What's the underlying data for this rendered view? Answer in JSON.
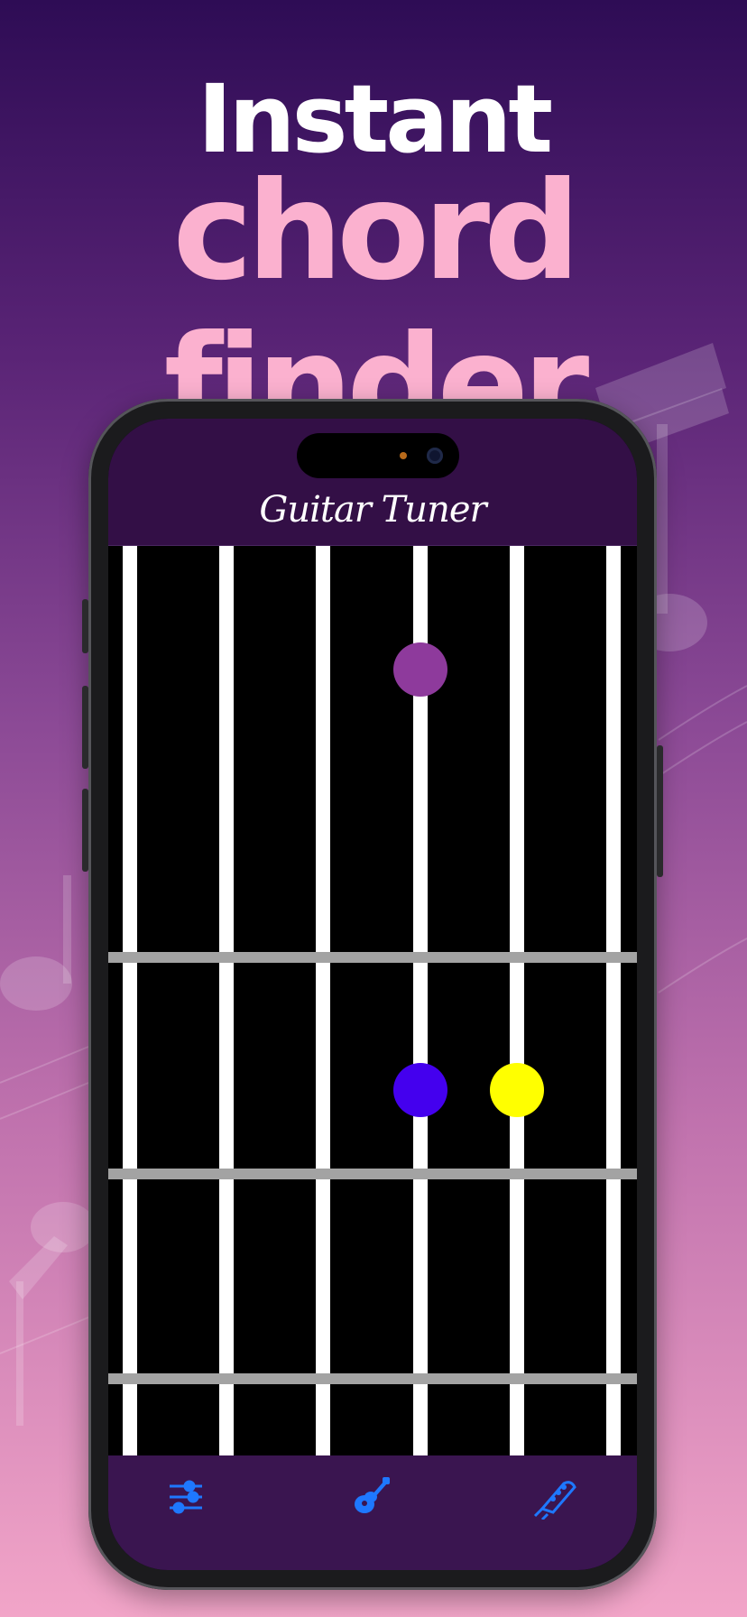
{
  "headline": {
    "line1": "Instant",
    "line2": "chord finder"
  },
  "app": {
    "title": "Guitar Tuner",
    "accent": "#1e78ff"
  },
  "fretboard": {
    "strings": 6,
    "frets_visible": 3,
    "finger_positions": [
      {
        "string": 4,
        "fret": 1,
        "color": "#8e3a9c"
      },
      {
        "string": 4,
        "fret": 2,
        "color": "#4400ee"
      },
      {
        "string": 5,
        "fret": 2,
        "color": "#ffff00"
      }
    ]
  },
  "tabbar": [
    {
      "name": "settings-tab",
      "icon": "sliders-icon"
    },
    {
      "name": "chords-tab",
      "icon": "guitar-icon"
    },
    {
      "name": "tuner-tab",
      "icon": "headstock-icon"
    }
  ]
}
